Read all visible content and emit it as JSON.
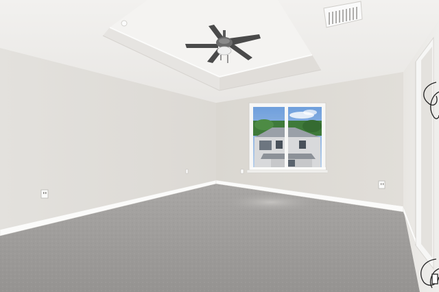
{
  "scene": {
    "subject": "empty-room",
    "elements": [
      "tray-ceiling",
      "ceiling-fan",
      "hvac-vent",
      "window",
      "carpet-floor",
      "baseboards",
      "wall-outlets",
      "doorway"
    ]
  },
  "colors": {
    "ceiling": "#efeeec",
    "left_wall": "#e4e2de",
    "back_wall": "#dedbd6",
    "right_wall": "#ebe9e6",
    "carpet": "#a19f9d",
    "baseboard": "#fbfbfa",
    "sky": "#8fb3e0",
    "trees": "#3f7a3a",
    "house": "#d8d9db",
    "fan_body": "#6c6c6c",
    "fan_blade": "#4a4a4a"
  }
}
